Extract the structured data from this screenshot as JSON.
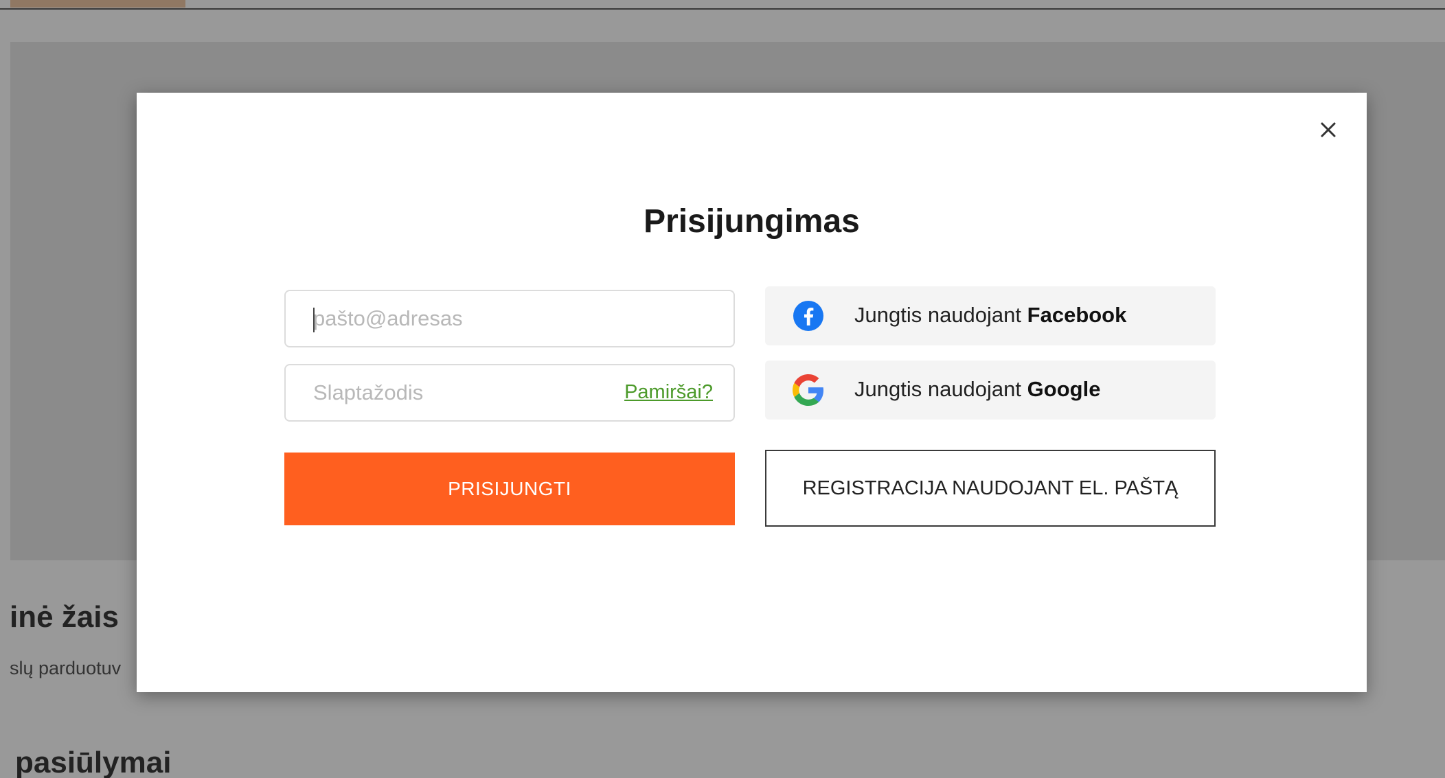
{
  "background": {
    "heading_1": "inė žais",
    "subtext_1": "slų parduotuv",
    "heading_2": "pasiūlymai"
  },
  "modal": {
    "title": "Prisijungimas",
    "email": {
      "placeholder": "pašto@adresas",
      "value": ""
    },
    "password": {
      "placeholder": "Slaptažodis",
      "value": "",
      "forgot_label": "Pamiršai?"
    },
    "login_label": "PRISIJUNGTI",
    "facebook": {
      "prefix": "Jungtis naudojant",
      "provider": "Facebook",
      "icon": "facebook-icon"
    },
    "google": {
      "prefix": "Jungtis naudojant",
      "provider": "Google",
      "icon": "google-icon"
    },
    "register_label": "REGISTRACIJA NAUDOJANT EL. PAŠTĄ",
    "close_icon": "close-icon"
  },
  "colors": {
    "accent": "#ff5f1f",
    "forgot_link": "#4c9a2a",
    "facebook": "#1877f2",
    "social_bg": "#f4f4f4"
  }
}
